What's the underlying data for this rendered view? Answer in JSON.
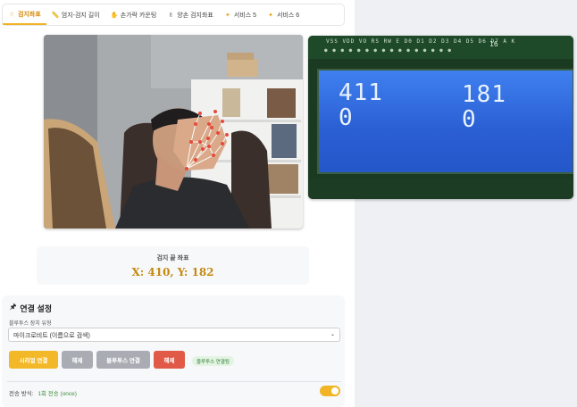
{
  "tabs": [
    {
      "label": "검지좌표",
      "icon": "pointing-hand-icon",
      "active": true
    },
    {
      "label": "엄지-검지 길이",
      "icon": "ruler-icon",
      "active": false
    },
    {
      "label": "손가락 카운팅",
      "icon": "hand-counting-icon",
      "active": false
    },
    {
      "label": "양손 검지좌표",
      "icon": "two-hands-icon",
      "active": false
    },
    {
      "label": "서비스 5",
      "icon": "sparkle-icon",
      "active": false
    },
    {
      "label": "서비스 6",
      "icon": "sparkle-icon",
      "active": false
    }
  ],
  "lcd": {
    "pin_labels": "VSS VDD VO RS RW E D0 D1 D2 D3 D4 D5 D6 D7 A K",
    "pin_number": "16",
    "row1_left": "411",
    "row1_right": "181",
    "row2_left": "0",
    "row2_right": "0"
  },
  "coord": {
    "label": "검지 끝 좌표",
    "value": "X: 410, Y: 182"
  },
  "connection": {
    "title": "연결 설정",
    "device_type_label": "블루투스 장치 유형",
    "device_select_value": "마이크로비트 (이름으로 검색)",
    "serial_connect_label": "시리얼 연결",
    "disconnect_label": "해제",
    "bt_connect_label": "블루투스 연결",
    "bt_disconnect_label": "해제",
    "bt_status_badge": "블루투스 연결됨",
    "tx_mode_label": "전송 방식:",
    "tx_mode_value": "1회 전송 (once)",
    "tx_toggle_on": true
  },
  "colors": {
    "accent": "#f1b323",
    "danger": "#e05a47",
    "success": "#2e7d32",
    "lcd_blue": "#2f67d6"
  }
}
